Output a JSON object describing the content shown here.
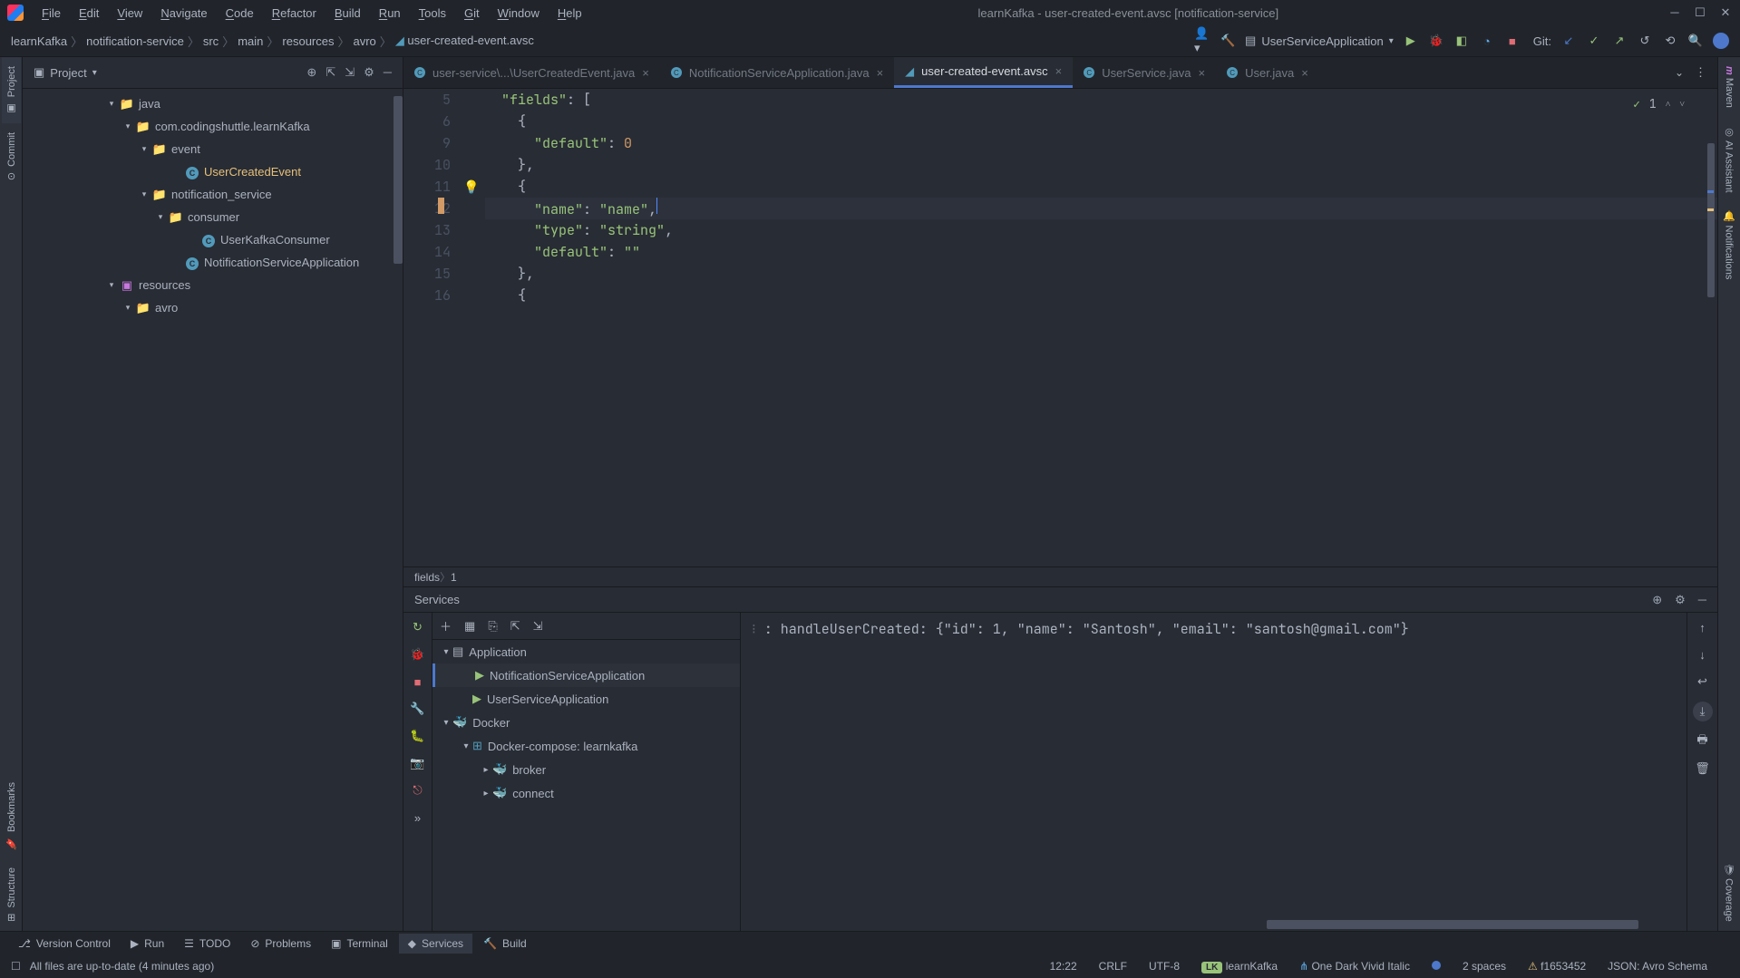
{
  "window": {
    "title": "learnKafka - user-created-event.avsc [notification-service]"
  },
  "menu": [
    "File",
    "Edit",
    "View",
    "Navigate",
    "Code",
    "Refactor",
    "Build",
    "Run",
    "Tools",
    "Git",
    "Window",
    "Help"
  ],
  "breadcrumb": [
    "learnKafka",
    "notification-service",
    "src",
    "main",
    "resources",
    "avro",
    "user-created-event.avsc"
  ],
  "runConfig": "UserServiceApplication",
  "gitLabel": "Git:",
  "leftTabs": [
    "Project",
    "Commit"
  ],
  "panel": {
    "title": "Project"
  },
  "tree": [
    {
      "indent": 5,
      "chevron": "▾",
      "icon": "folder",
      "label": "java"
    },
    {
      "indent": 6,
      "chevron": "▾",
      "icon": "folder",
      "label": "com.codingshuttle.learnKafka"
    },
    {
      "indent": 7,
      "chevron": "▾",
      "icon": "folder",
      "label": "event"
    },
    {
      "indent": 9,
      "chevron": "",
      "icon": "class",
      "label": "UserCreatedEvent",
      "hl": true
    },
    {
      "indent": 7,
      "chevron": "▾",
      "icon": "folder",
      "label": "notification_service"
    },
    {
      "indent": 8,
      "chevron": "▾",
      "icon": "folder",
      "label": "consumer"
    },
    {
      "indent": 10,
      "chevron": "",
      "icon": "class",
      "label": "UserKafkaConsumer"
    },
    {
      "indent": 9,
      "chevron": "",
      "icon": "class",
      "label": "NotificationServiceApplication"
    },
    {
      "indent": 5,
      "chevron": "▾",
      "icon": "resources",
      "label": "resources"
    },
    {
      "indent": 6,
      "chevron": "▾",
      "icon": "folder",
      "label": "avro"
    }
  ],
  "editorTabs": [
    {
      "label": "user-service\\...\\UserCreatedEvent.java",
      "icon": "c",
      "active": false
    },
    {
      "label": "NotificationServiceApplication.java",
      "icon": "c",
      "active": false
    },
    {
      "label": "user-created-event.avsc",
      "icon": "avro",
      "active": true
    },
    {
      "label": "UserService.java",
      "icon": "c",
      "active": false
    },
    {
      "label": "User.java",
      "icon": "c",
      "active": false
    }
  ],
  "inspection": {
    "count": "1"
  },
  "gutterStart": 5,
  "codeLines": [
    {
      "n": 5,
      "t": [
        {
          "c": "  ",
          "cl": ""
        },
        {
          "c": "\"fields\"",
          "cl": "s-key"
        },
        {
          "c": ": [",
          "cl": "s-punc"
        }
      ]
    },
    {
      "n": 6,
      "t": [
        {
          "c": "    {",
          "cl": "s-punc"
        }
      ]
    },
    {
      "n": 9,
      "t": [
        {
          "c": "      ",
          "cl": ""
        },
        {
          "c": "\"default\"",
          "cl": "s-key"
        },
        {
          "c": ": ",
          "cl": "s-punc"
        },
        {
          "c": "0",
          "cl": "s-num"
        }
      ]
    },
    {
      "n": 10,
      "t": [
        {
          "c": "    },",
          "cl": "s-punc"
        }
      ]
    },
    {
      "n": 11,
      "t": [
        {
          "c": "    {",
          "cl": "s-punc"
        }
      ]
    },
    {
      "n": 12,
      "active": true,
      "t": [
        {
          "c": "      ",
          "cl": ""
        },
        {
          "c": "\"name\"",
          "cl": "s-key"
        },
        {
          "c": ": ",
          "cl": "s-punc"
        },
        {
          "c": "\"name\"",
          "cl": "s-str"
        },
        {
          "c": ",",
          "cl": "s-punc"
        }
      ]
    },
    {
      "n": 13,
      "t": [
        {
          "c": "      ",
          "cl": ""
        },
        {
          "c": "\"type\"",
          "cl": "s-key"
        },
        {
          "c": ": ",
          "cl": "s-punc"
        },
        {
          "c": "\"string\"",
          "cl": "s-str"
        },
        {
          "c": ",",
          "cl": "s-punc"
        }
      ]
    },
    {
      "n": 14,
      "t": [
        {
          "c": "      ",
          "cl": ""
        },
        {
          "c": "\"default\"",
          "cl": "s-key"
        },
        {
          "c": ": ",
          "cl": "s-punc"
        },
        {
          "c": "\"\"",
          "cl": "s-str"
        }
      ]
    },
    {
      "n": 15,
      "t": [
        {
          "c": "    },",
          "cl": "s-punc"
        }
      ]
    },
    {
      "n": 16,
      "t": [
        {
          "c": "    {",
          "cl": "s-punc"
        }
      ]
    }
  ],
  "codeBreadcrumb": [
    "fields",
    "1"
  ],
  "services": {
    "title": "Services",
    "tree": [
      {
        "indent": 0,
        "chevron": "▾",
        "icon": "app",
        "label": "Application"
      },
      {
        "indent": 1,
        "chevron": "",
        "icon": "run",
        "label": "NotificationServiceApplication",
        "selected": true
      },
      {
        "indent": 1,
        "chevron": "",
        "icon": "run",
        "label": "UserServiceApplication"
      },
      {
        "indent": 0,
        "chevron": "▾",
        "icon": "docker",
        "label": "Docker"
      },
      {
        "indent": 1,
        "chevron": "▾",
        "icon": "compose",
        "label": "Docker-compose: learnkafka"
      },
      {
        "indent": 2,
        "chevron": "▸",
        "icon": "docker",
        "label": "broker"
      },
      {
        "indent": 2,
        "chevron": "▸",
        "icon": "docker",
        "label": "connect"
      }
    ],
    "output": "                : handleUserCreated: {\"id\": 1, \"name\": \"Santosh\", \"email\": \"santosh@gmail.com\"}"
  },
  "bottomTools": [
    {
      "icon": "⎇",
      "label": "Version Control"
    },
    {
      "icon": "▶",
      "label": "Run"
    },
    {
      "icon": "☰",
      "label": "TODO"
    },
    {
      "icon": "⊘",
      "label": "Problems"
    },
    {
      "icon": "▣",
      "label": "Terminal"
    },
    {
      "icon": "◆",
      "label": "Services",
      "active": true
    },
    {
      "icon": "🔨",
      "label": "Build"
    }
  ],
  "statusLeft": "All files are up-to-date (4 minutes ago)",
  "status": {
    "time": "12:22",
    "lineEnding": "CRLF",
    "encoding": "UTF-8",
    "branchPill": "LK",
    "project": "learnKafka",
    "theme": "One Dark Vivid Italic",
    "indent": "2 spaces",
    "commit": "f1653452",
    "lang": "JSON: Avro Schema"
  },
  "rightTabs": [
    "Maven",
    "AI Assistant",
    "Notifications",
    "Coverage"
  ],
  "leftBottomTabs": [
    "Bookmarks",
    "Structure"
  ]
}
